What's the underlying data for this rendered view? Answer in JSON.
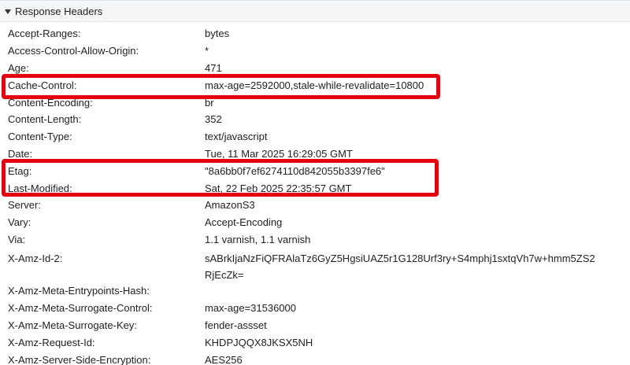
{
  "section": {
    "title": "Response Headers",
    "expanded": true
  },
  "headers": [
    {
      "name": "Accept-Ranges:",
      "value": "bytes"
    },
    {
      "name": "Access-Control-Allow-Origin:",
      "value": "*"
    },
    {
      "name": "Age:",
      "value": "471"
    },
    {
      "name": "Cache-Control:",
      "value": "max-age=2592000,stale-while-revalidate=10800"
    },
    {
      "name": "Content-Encoding:",
      "value": "br"
    },
    {
      "name": "Content-Length:",
      "value": "352"
    },
    {
      "name": "Content-Type:",
      "value": "text/javascript"
    },
    {
      "name": "Date:",
      "value": "Tue, 11 Mar 2025 16:29:05 GMT"
    },
    {
      "name": "Etag:",
      "value": "\"8a6bb0f7ef6274110d842055b3397fe6\""
    },
    {
      "name": "Last-Modified:",
      "value": "Sat, 22 Feb 2025 22:35:57 GMT"
    },
    {
      "name": "Server:",
      "value": "AmazonS3"
    },
    {
      "name": "Vary:",
      "value": "Accept-Encoding"
    },
    {
      "name": "Via:",
      "value": "1.1 varnish, 1.1 varnish"
    },
    {
      "name": "X-Amz-Id-2:",
      "value": "sABrkIjaNzFiQFRAlaTz6GyZ5HgsiUAZ5r1G128Urf3ry+S4mphj1sxtqVh7w+hmm5ZS2RjEcZk="
    },
    {
      "name": "X-Amz-Meta-Entrypoints-Hash:",
      "value": ""
    },
    {
      "name": "X-Amz-Meta-Surrogate-Control:",
      "value": "max-age=31536000"
    },
    {
      "name": "X-Amz-Meta-Surrogate-Key:",
      "value": "fender-assset"
    },
    {
      "name": "X-Amz-Request-Id:",
      "value": "KHDPJQQX8JKSX5NH"
    },
    {
      "name": "X-Amz-Server-Side-Encryption:",
      "value": "AES256"
    }
  ],
  "colors": {
    "highlight": "#e3000f",
    "header_bg": "#f4f6f8"
  }
}
